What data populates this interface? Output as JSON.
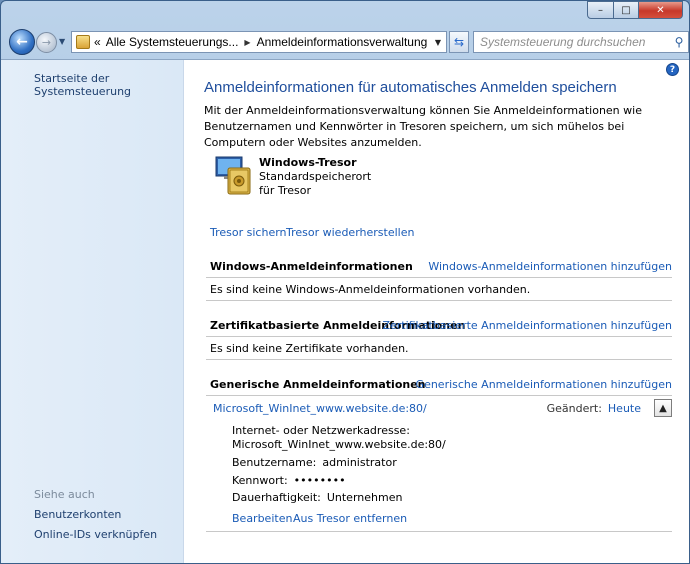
{
  "window": {
    "minimize": "–",
    "maximize": "□",
    "close": "✕"
  },
  "nav": {
    "back": "←",
    "forward": "→",
    "breadcrumb_overflow": "«",
    "crumbs": [
      "Alle Systemsteuerungs...",
      "Anmeldeinformationsverwaltung"
    ],
    "search_placeholder": "Systemsteuerung durchsuchen"
  },
  "sidebar": {
    "home": "Startseite der Systemsteuerung",
    "see_also_label": "Siehe auch",
    "links": [
      "Benutzerkonten",
      "Online-IDs verknüpfen"
    ]
  },
  "main": {
    "title": "Anmeldeinformationen für automatisches Anmelden speichern",
    "intro": "Mit der Anmeldeinformationsverwaltung können Sie Anmeldeinformationen wie Benutzernamen und Kennwörter in Tresoren speichern, um sich mühelos bei Computern oder Websites anzumelden.",
    "vault": {
      "title": "Windows-Tresor",
      "subtitle": "Standardspeicherort für Tresor"
    },
    "actions": {
      "backup": "Tresor sichern",
      "restore": "Tresor wiederherstellen"
    },
    "sections": [
      {
        "heading": "Windows-Anmeldeinformationen",
        "add": "Windows-Anmeldeinformationen hinzufügen",
        "empty": "Es sind keine Windows-Anmeldeinformationen vorhanden."
      },
      {
        "heading": "Zertifikatbasierte Anmeldeinformationen",
        "add": "Zertifikatbasierte Anmeldeinformationen hinzufügen",
        "empty": "Es sind keine Zertifikate vorhanden."
      },
      {
        "heading": "Generische Anmeldeinformationen",
        "add": "Generische Anmeldeinformationen hinzufügen"
      }
    ],
    "credential": {
      "name": "Microsoft_WinInet_www.website.de:80/",
      "modified_label": "Geändert:",
      "modified_value": "Heute",
      "address_label": "Internet- oder Netzwerkadresse:",
      "address_value": "Microsoft_WinInet_www.website.de:80/",
      "user_label": "Benutzername:",
      "user_value": "administrator",
      "password_label": "Kennwort:",
      "password_value": "••••••••",
      "persistence_label": "Dauerhaftigkeit:",
      "persistence_value": "Unternehmen",
      "edit": "Bearbeiten",
      "remove": "Aus Tresor entfernen"
    }
  }
}
